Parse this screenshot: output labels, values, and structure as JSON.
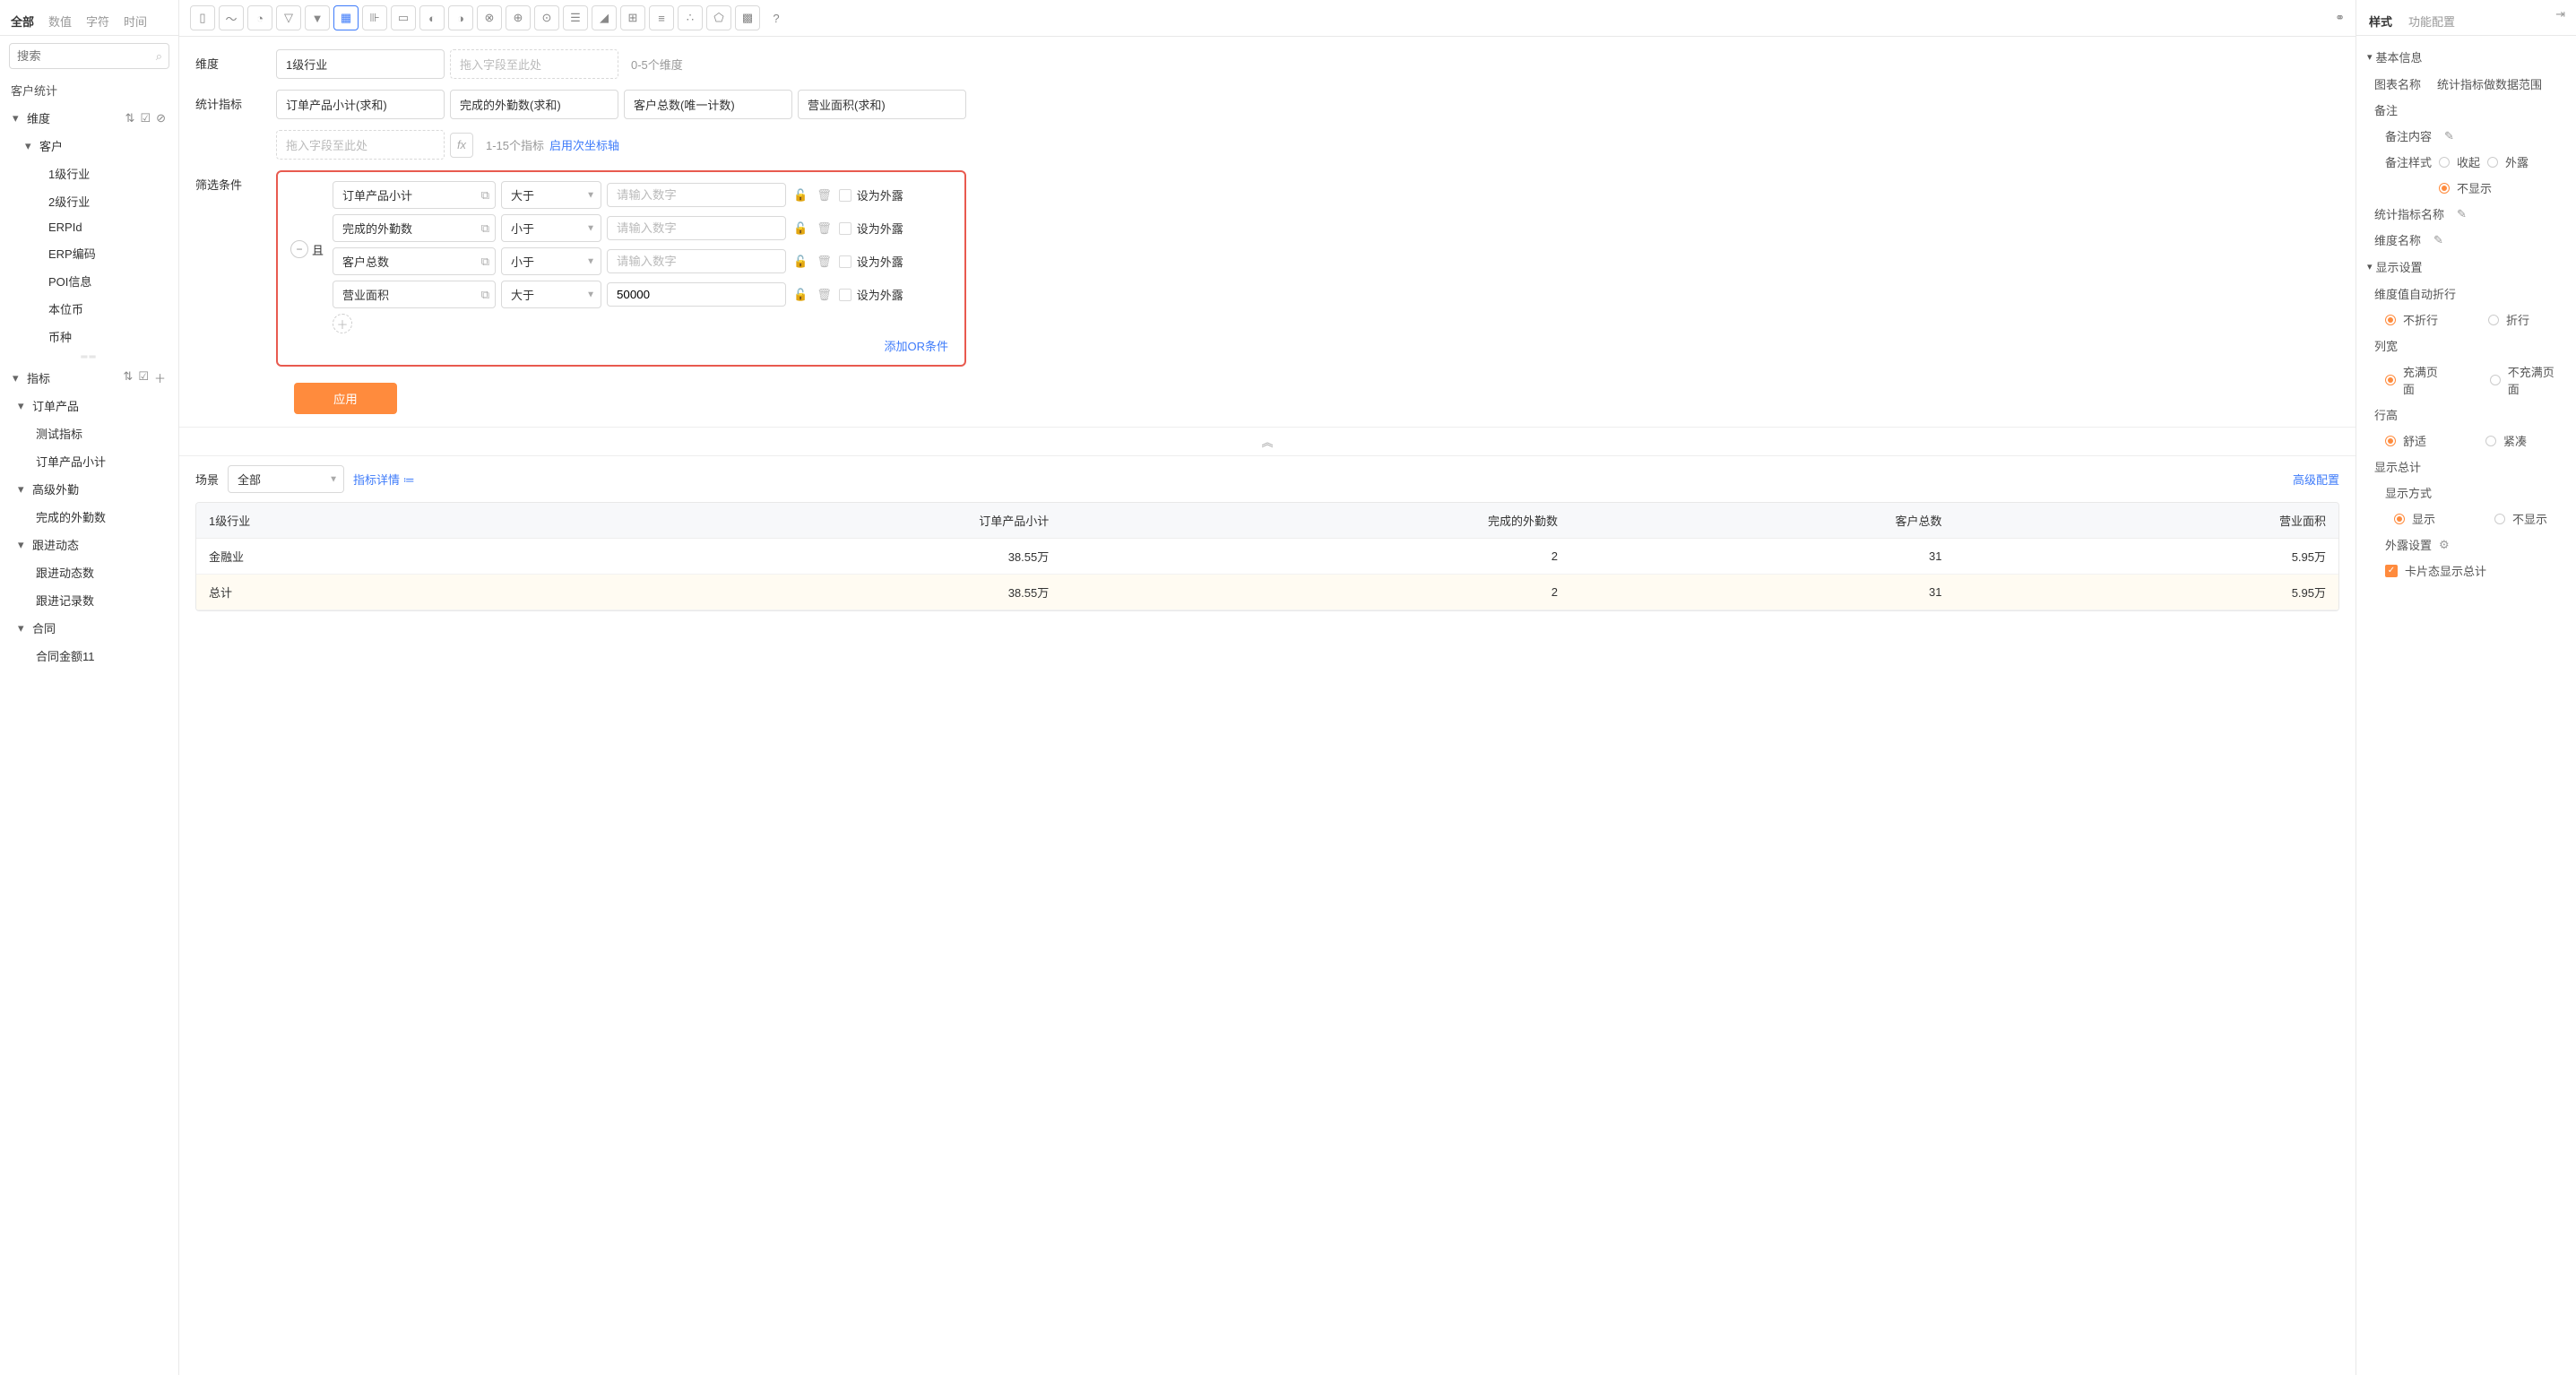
{
  "leftTabs": [
    "全部",
    "数值",
    "字符",
    "时间"
  ],
  "searchPlaceholder": "搜索",
  "sectionTitle": "客户统计",
  "dimGroupLabel": "维度",
  "customerLabel": "客户",
  "dimItems": [
    "1级行业",
    "2级行业",
    "ERPId",
    "ERP编码",
    "POI信息",
    "本位币",
    "币种"
  ],
  "metricGroupLabel": "指标",
  "metricGroups": [
    {
      "name": "订单产品",
      "items": [
        "测试指标",
        "订单产品小计"
      ]
    },
    {
      "name": "高级外勤",
      "items": [
        "完成的外勤数"
      ]
    },
    {
      "name": "跟进动态",
      "items": [
        "跟进动态数",
        "跟进记录数"
      ]
    },
    {
      "name": "合同",
      "items": [
        "合同金额11"
      ]
    }
  ],
  "toolbar": {
    "help": "?"
  },
  "config": {
    "dimLabel": "维度",
    "dimChip": "1级行业",
    "dimPlaceholder": "拖入字段至此处",
    "dimHint": "0-5个维度",
    "metricLabel": "统计指标",
    "metricChips": [
      "订单产品小计(求和)",
      "完成的外勤数(求和)",
      "客户总数(唯一计数)",
      "营业面积(求和)"
    ],
    "metricPlaceholder": "拖入字段至此处",
    "fx": "fx",
    "metricHint": "1-15个指标",
    "axisLink": "启用次坐标轴",
    "filterLabel": "筛选条件",
    "logicAnd": "且",
    "filters": [
      {
        "field": "订单产品小计",
        "op": "大于",
        "val": "",
        "ph": "请输入数字"
      },
      {
        "field": "完成的外勤数",
        "op": "小于",
        "val": "",
        "ph": "请输入数字"
      },
      {
        "field": "客户总数",
        "op": "小于",
        "val": "",
        "ph": "请输入数字"
      },
      {
        "field": "营业面积",
        "op": "大于",
        "val": "50000",
        "ph": "请输入数字"
      }
    ],
    "exposeLabel": "设为外露",
    "addOr": "添加OR条件",
    "applyBtn": "应用"
  },
  "scene": {
    "label": "场景",
    "value": "全部",
    "detailLink": "指标详情",
    "advanced": "高级配置"
  },
  "table": {
    "headers": [
      "1级行业",
      "订单产品小计",
      "完成的外勤数",
      "客户总数",
      "营业面积"
    ],
    "rows": [
      [
        "金融业",
        "38.55万",
        "2",
        "31",
        "5.95万"
      ]
    ],
    "total": [
      "总计",
      "38.55万",
      "2",
      "31",
      "5.95万"
    ]
  },
  "right": {
    "tabs": [
      "样式",
      "功能配置"
    ],
    "basicHead": "基本信息",
    "chartNameLabel": "图表名称",
    "chartNameVal": "统计指标做数据范围",
    "noteLabel": "备注",
    "noteContentLabel": "备注内容",
    "noteStyleLabel": "备注样式",
    "opt_collapse": "收起",
    "opt_expose": "外露",
    "opt_noshow": "不显示",
    "metricNameLabel": "统计指标名称",
    "dimNameLabel": "维度名称",
    "displayHead": "显示设置",
    "autoWrapLabel": "维度值自动折行",
    "opt_nowrap": "不折行",
    "opt_wrap": "折行",
    "colWidthLabel": "列宽",
    "opt_fill": "充满页面",
    "opt_nofill": "不充满页面",
    "rowHeightLabel": "行高",
    "opt_comfort": "舒适",
    "opt_compact": "紧凑",
    "showTotalLabel": "显示总计",
    "displayModeLabel": "显示方式",
    "opt_show": "显示",
    "opt_hide": "不显示",
    "exposeSetLabel": "外露设置",
    "cardTotalLabel": "卡片态显示总计"
  }
}
